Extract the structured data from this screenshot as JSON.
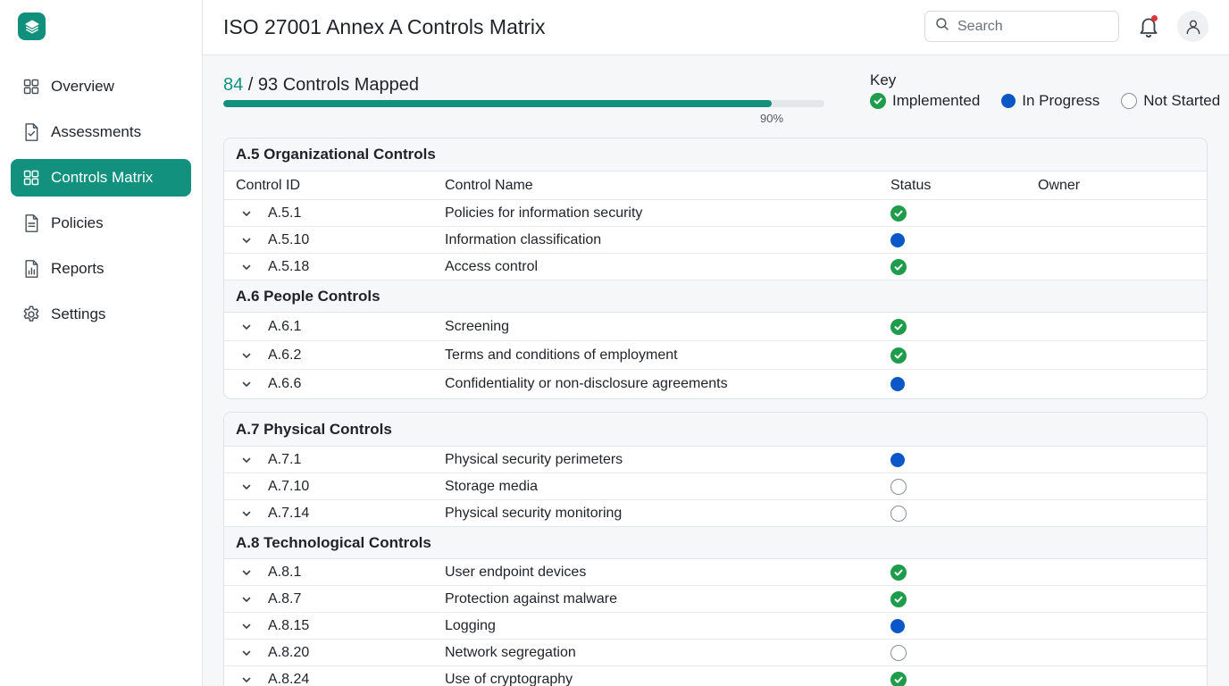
{
  "app": {
    "colors": {
      "accent": "#12917f",
      "implemented": "#1e9b4b",
      "in_progress": "#0b57c8",
      "not_started": "#8a9096"
    }
  },
  "sidebar": {
    "logo_icon": "layers-icon",
    "items": [
      {
        "label": "Overview",
        "icon": "grid-icon",
        "active": false
      },
      {
        "label": "Assessments",
        "icon": "clipboard-check-icon",
        "active": false
      },
      {
        "label": "Controls Matrix",
        "icon": "grid-icon",
        "active": true
      },
      {
        "label": "Policies",
        "icon": "document-icon",
        "active": false
      },
      {
        "label": "Reports",
        "icon": "report-chart-icon",
        "active": false
      },
      {
        "label": "Settings",
        "icon": "gear-icon",
        "active": false
      }
    ]
  },
  "header": {
    "title": "ISO 27001 Annex A Controls Matrix",
    "search": {
      "placeholder": "Search",
      "value": ""
    },
    "notifications_icon": "bell-icon",
    "user_icon": "user-icon"
  },
  "progress": {
    "mapped": "84",
    "rest": " / 93 Controls Mapped",
    "percent_label": "90%",
    "fraction": 0.912
  },
  "key": {
    "title": "Key",
    "items": [
      {
        "status": "implemented",
        "label": "Implemented"
      },
      {
        "status": "in_progress",
        "label": "In Progress"
      },
      {
        "status": "not_started",
        "label": "Not Started"
      }
    ]
  },
  "table": {
    "columns": {
      "id": "Control ID",
      "name": "Control Name",
      "status": "Status",
      "owner": "Owner"
    },
    "panels": [
      {
        "sections": [
          {
            "title": "A.5 Organizational Controls",
            "rows": [
              {
                "id": "A.5.1",
                "name": "Policies for information security",
                "status": "implemented",
                "owner": ""
              },
              {
                "id": "A.5.10",
                "name": "Information classification",
                "status": "in_progress",
                "owner": ""
              },
              {
                "id": "A.5.18",
                "name": "Access control",
                "status": "implemented",
                "owner": ""
              }
            ]
          },
          {
            "title": "A.6 People Controls",
            "rows": [
              {
                "id": "A.6.1",
                "name": "Screening",
                "status": "implemented",
                "owner": ""
              },
              {
                "id": "A.6.2",
                "name": "Terms and conditions of employment",
                "status": "implemented",
                "owner": ""
              },
              {
                "id": "A.6.6",
                "name": "Confidentiality or non-disclosure agreements",
                "status": "in_progress",
                "owner": ""
              }
            ]
          }
        ]
      },
      {
        "sections": [
          {
            "title": "A.7 Physical Controls",
            "rows": [
              {
                "id": "A.7.1",
                "name": "Physical security perimeters",
                "status": "in_progress",
                "owner": ""
              },
              {
                "id": "A.7.10",
                "name": "Storage media",
                "status": "not_started",
                "owner": ""
              },
              {
                "id": "A.7.14",
                "name": "Physical security monitoring",
                "status": "not_started",
                "owner": ""
              }
            ]
          },
          {
            "title": "A.8 Technological Controls",
            "rows": [
              {
                "id": "A.8.1",
                "name": "User endpoint devices",
                "status": "implemented",
                "owner": ""
              },
              {
                "id": "A.8.7",
                "name": "Protection against malware",
                "status": "implemented",
                "owner": ""
              },
              {
                "id": "A.8.15",
                "name": "Logging",
                "status": "in_progress",
                "owner": ""
              },
              {
                "id": "A.8.20",
                "name": "Network segregation",
                "status": "not_started",
                "owner": ""
              },
              {
                "id": "A.8.24",
                "name": "Use of cryptography",
                "status": "implemented",
                "owner": ""
              }
            ]
          }
        ]
      }
    ]
  }
}
